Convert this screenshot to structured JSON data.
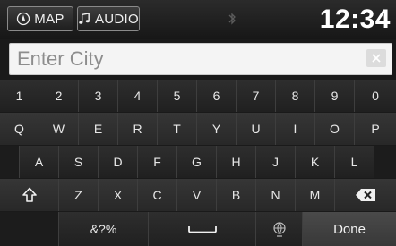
{
  "status_bar": {
    "map_label": "MAP",
    "audio_label": "AUDIO",
    "clock": "12:34"
  },
  "search": {
    "placeholder": "Enter City",
    "value": ""
  },
  "keyboard": {
    "row1": [
      "1",
      "2",
      "3",
      "4",
      "5",
      "6",
      "7",
      "8",
      "9",
      "0"
    ],
    "row2": [
      "Q",
      "W",
      "E",
      "R",
      "T",
      "Y",
      "U",
      "I",
      "O",
      "P"
    ],
    "row3": [
      "A",
      "S",
      "D",
      "F",
      "G",
      "H",
      "J",
      "K",
      "L"
    ],
    "row4": [
      "Z",
      "X",
      "C",
      "V",
      "B",
      "N",
      "M"
    ],
    "symbols_label": "&?%",
    "done_label": "Done"
  },
  "icons": {
    "map": "compass-icon",
    "audio": "music-note-icon",
    "bluetooth": "bluetooth-icon",
    "clear": "clear-x-icon",
    "shift": "shift-arrow-icon",
    "backspace": "backspace-icon",
    "space": "space-bar-icon",
    "voice": "voice-globe-icon"
  }
}
